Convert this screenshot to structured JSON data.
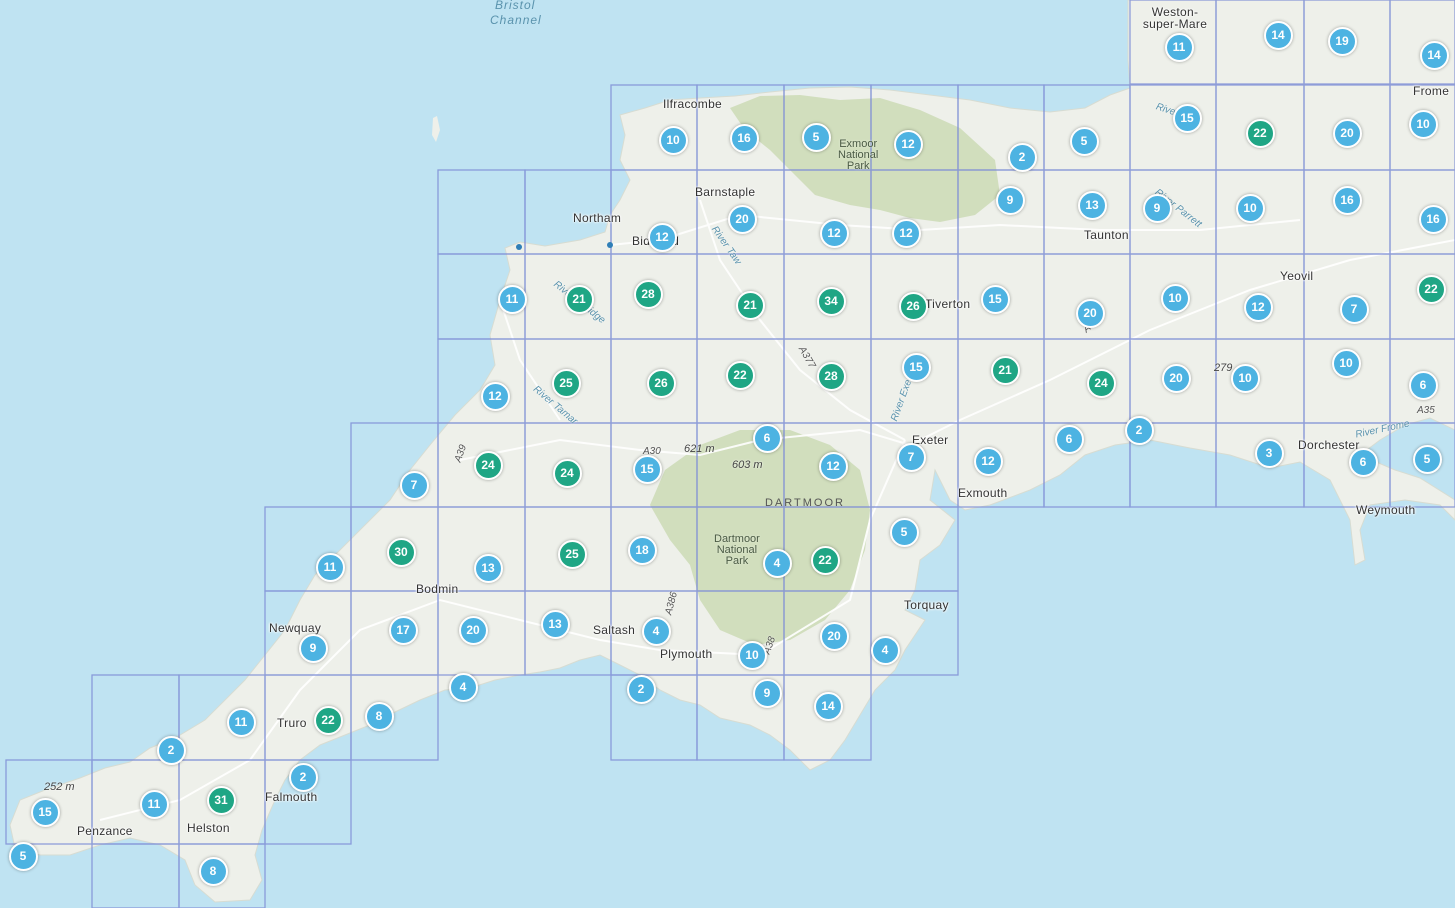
{
  "colors": {
    "sea": "#bfe3f2",
    "land": "#eef0ea",
    "national_park": "#cbdab5",
    "grid_line": "#7f8fd6",
    "cluster_small": "#4db3e2",
    "cluster_large": "#1fa685"
  },
  "water_labels": [
    "Bristol",
    "Channel"
  ],
  "places": [
    "Weston-super-Mare",
    "Ilfracombe",
    "Barnstaple",
    "Northam",
    "Bideford",
    "Taunton",
    "Yeovil",
    "Frome",
    "Tiverton",
    "Exeter",
    "Exmouth",
    "Dorchester",
    "Weymouth",
    "Torquay",
    "Plymouth",
    "Saltash",
    "Bodmin",
    "Newquay",
    "Truro",
    "Falmouth",
    "Helston",
    "Penzance"
  ],
  "parks": [
    "Exmoor\nNational\nPark",
    "Dartmoor\nNational\nPark"
  ],
  "region_labels": [
    "DARTMOOR"
  ],
  "elevations": [
    "621 m",
    "603 m",
    "252 m",
    "279"
  ],
  "rivers": [
    "River Taw",
    "River Torridge",
    "River Tamar",
    "River Exe",
    "River Parrett",
    "River Frome",
    "River Cue"
  ],
  "roads": [
    "A39",
    "A30",
    "A377",
    "A386",
    "A303",
    "A35",
    "A38"
  ],
  "clusters": [
    {
      "count": "11",
      "size": "small"
    },
    {
      "count": "14",
      "size": "small"
    },
    {
      "count": "19",
      "size": "small"
    },
    {
      "count": "14",
      "size": "small"
    },
    {
      "count": "10",
      "size": "small"
    },
    {
      "count": "16",
      "size": "small"
    },
    {
      "count": "5",
      "size": "small"
    },
    {
      "count": "12",
      "size": "small"
    },
    {
      "count": "2",
      "size": "small"
    },
    {
      "count": "5",
      "size": "small"
    },
    {
      "count": "15",
      "size": "small"
    },
    {
      "count": "22",
      "size": "large"
    },
    {
      "count": "20",
      "size": "small"
    },
    {
      "count": "10",
      "size": "small"
    },
    {
      "count": "9",
      "size": "small"
    },
    {
      "count": "13",
      "size": "small"
    },
    {
      "count": "9",
      "size": "small"
    },
    {
      "count": "10",
      "size": "small"
    },
    {
      "count": "16",
      "size": "small"
    },
    {
      "count": "16",
      "size": "small"
    },
    {
      "count": "20",
      "size": "small"
    },
    {
      "count": "12",
      "size": "small"
    },
    {
      "count": "12",
      "size": "small"
    },
    {
      "count": "12",
      "size": "small"
    },
    {
      "count": "11",
      "size": "small"
    },
    {
      "count": "21",
      "size": "large"
    },
    {
      "count": "28",
      "size": "large"
    },
    {
      "count": "21",
      "size": "large"
    },
    {
      "count": "34",
      "size": "large"
    },
    {
      "count": "26",
      "size": "large"
    },
    {
      "count": "15",
      "size": "small"
    },
    {
      "count": "20",
      "size": "small"
    },
    {
      "count": "10",
      "size": "small"
    },
    {
      "count": "12",
      "size": "small"
    },
    {
      "count": "7",
      "size": "small"
    },
    {
      "count": "22",
      "size": "large"
    },
    {
      "count": "12",
      "size": "small"
    },
    {
      "count": "25",
      "size": "large"
    },
    {
      "count": "26",
      "size": "large"
    },
    {
      "count": "22",
      "size": "large"
    },
    {
      "count": "28",
      "size": "large"
    },
    {
      "count": "15",
      "size": "small"
    },
    {
      "count": "21",
      "size": "large"
    },
    {
      "count": "24",
      "size": "large"
    },
    {
      "count": "20",
      "size": "small"
    },
    {
      "count": "10",
      "size": "small"
    },
    {
      "count": "10",
      "size": "small"
    },
    {
      "count": "6",
      "size": "small"
    },
    {
      "count": "6",
      "size": "small"
    },
    {
      "count": "2",
      "size": "small"
    },
    {
      "count": "3",
      "size": "small"
    },
    {
      "count": "6",
      "size": "small"
    },
    {
      "count": "5",
      "size": "small"
    },
    {
      "count": "7",
      "size": "small"
    },
    {
      "count": "24",
      "size": "large"
    },
    {
      "count": "24",
      "size": "large"
    },
    {
      "count": "15",
      "size": "small"
    },
    {
      "count": "12",
      "size": "small"
    },
    {
      "count": "7",
      "size": "small"
    },
    {
      "count": "12",
      "size": "small"
    },
    {
      "count": "6",
      "size": "small"
    },
    {
      "count": "11",
      "size": "small"
    },
    {
      "count": "30",
      "size": "large"
    },
    {
      "count": "13",
      "size": "small"
    },
    {
      "count": "25",
      "size": "large"
    },
    {
      "count": "18",
      "size": "small"
    },
    {
      "count": "4",
      "size": "small"
    },
    {
      "count": "22",
      "size": "large"
    },
    {
      "count": "5",
      "size": "small"
    },
    {
      "count": "9",
      "size": "small"
    },
    {
      "count": "17",
      "size": "small"
    },
    {
      "count": "20",
      "size": "small"
    },
    {
      "count": "13",
      "size": "small"
    },
    {
      "count": "4",
      "size": "small"
    },
    {
      "count": "10",
      "size": "small"
    },
    {
      "count": "20",
      "size": "small"
    },
    {
      "count": "4",
      "size": "small"
    },
    {
      "count": "4",
      "size": "small"
    },
    {
      "count": "2",
      "size": "small"
    },
    {
      "count": "9",
      "size": "small"
    },
    {
      "count": "14",
      "size": "small"
    },
    {
      "count": "11",
      "size": "small"
    },
    {
      "count": "22",
      "size": "large"
    },
    {
      "count": "8",
      "size": "small"
    },
    {
      "count": "2",
      "size": "small"
    },
    {
      "count": "2",
      "size": "small"
    },
    {
      "count": "15",
      "size": "small"
    },
    {
      "count": "11",
      "size": "small"
    },
    {
      "count": "31",
      "size": "large"
    },
    {
      "count": "5",
      "size": "small"
    },
    {
      "count": "8",
      "size": "small"
    }
  ]
}
